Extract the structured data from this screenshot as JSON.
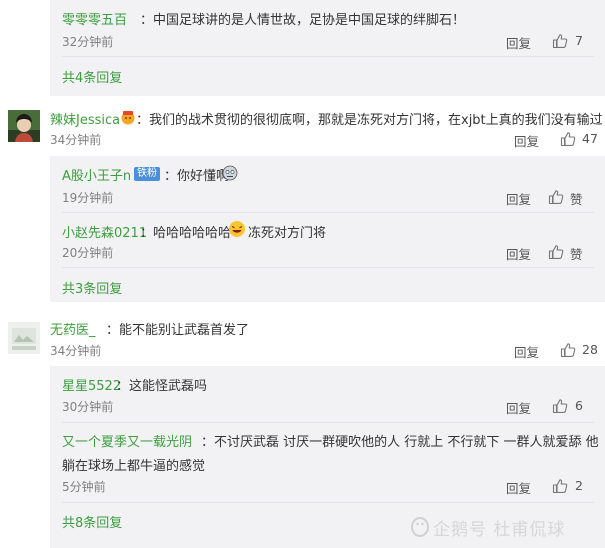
{
  "ui": {
    "reply_label": "回复",
    "like_icon": "thumbs-up-icon",
    "like_label": "赞"
  },
  "top_reply": {
    "user": "零零零五百",
    "text": "：中国足球讲的是人情世故，足协是中国足球的绊脚石！",
    "time": "32分钟前",
    "likes": "7",
    "more": "共4条回复"
  },
  "comments": [
    {
      "user": "辣妹Jessica",
      "text": "：我们的战术贯彻的很彻底啊，那就是冻死对方门将，在xjbt上真的我们没有输过",
      "time": "34分钟前",
      "likes": "47",
      "replies": [
        {
          "user": "A股小王子n",
          "badge": "铁粉",
          "text": "：你好懂啊",
          "time": "19分钟前",
          "likes": "赞"
        },
        {
          "user": "小赵先森0211",
          "text_a": "：哈哈哈哈哈哈",
          "text_b": "冻死对方门将",
          "time": "20分钟前",
          "likes": "赞"
        }
      ],
      "more": "共3条回复"
    },
    {
      "user": "无药医_",
      "text": "：能不能别让武磊首发了",
      "time": "34分钟前",
      "likes": "28",
      "replies": [
        {
          "user": "星星5522",
          "text": "：这能怪武磊吗",
          "time": "30分钟前",
          "likes": "6"
        },
        {
          "user": "又一个夏季又一载光阴",
          "text": "：不讨厌武磊 讨厌一群硬吹他的人 行就上 不行就下 一群人就爱舔 他",
          "text2": "躺在球场上都牛逼的感觉",
          "time": "5分钟前",
          "likes": "2"
        }
      ],
      "more": "共8条回复"
    }
  ],
  "watermark": "企鹅号 杜甫侃球"
}
